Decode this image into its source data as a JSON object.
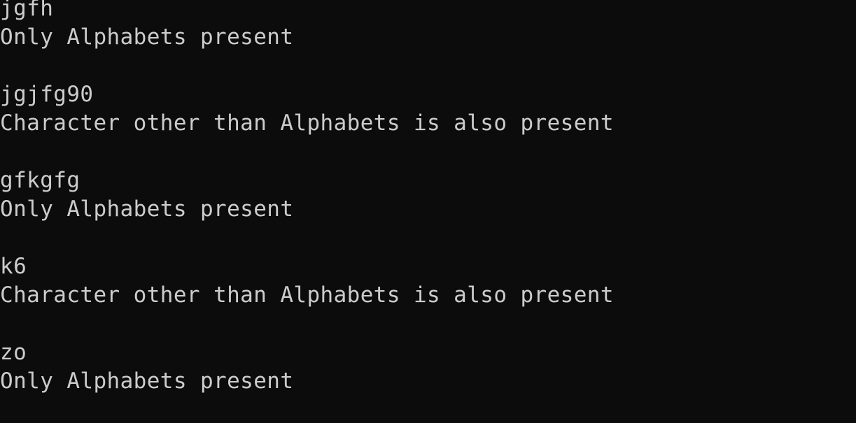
{
  "console": {
    "background_color": "#0c0c0c",
    "text_color": "#cccccc",
    "entries": [
      {
        "input": "jgfh",
        "output": "Only Alphabets present"
      },
      {
        "input": "jgjfg90",
        "output": "Character other than Alphabets is also present"
      },
      {
        "input": "gfkgfg",
        "output": "Only Alphabets present"
      },
      {
        "input": "k6",
        "output": "Character other than Alphabets is also present"
      },
      {
        "input": "zo",
        "output": "Only Alphabets present"
      }
    ]
  }
}
